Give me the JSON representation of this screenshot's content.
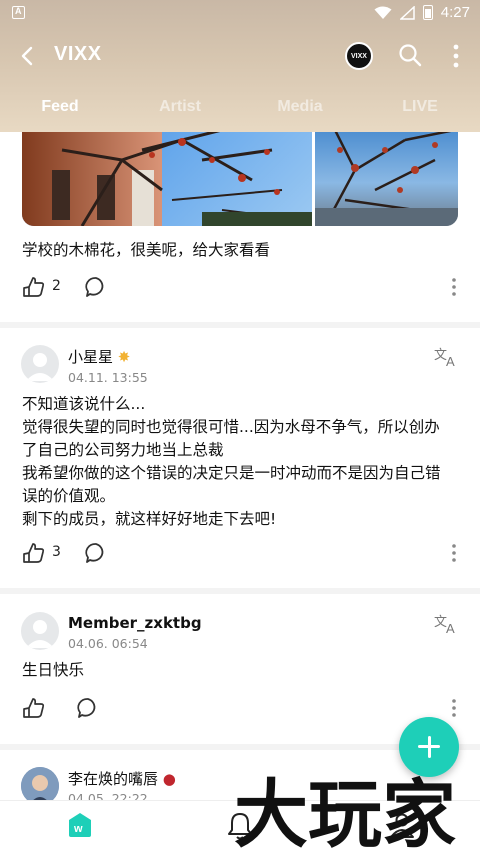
{
  "statusbar": {
    "time": "4:27"
  },
  "appbar": {
    "title": "VIXX",
    "logo_text": "VIXX"
  },
  "tabs": [
    {
      "label": "Feed",
      "active": true
    },
    {
      "label": "Artist",
      "active": false
    },
    {
      "label": "Media",
      "active": false
    },
    {
      "label": "LIVE",
      "active": false
    }
  ],
  "posts": [
    {
      "text": "学校的木棉花，很美呢，给大家看看",
      "likes": "2"
    },
    {
      "username": "小星星",
      "time": "04.11. 13:55",
      "lines": [
        "不知道该说什么...",
        "觉得很失望的同时也觉得很可惜...因为水母不争气，所以创办",
        "了自己的公司努力地当上总裁",
        "我希望你做的这个错误的决定只是一时冲动而不是因为自己错",
        "误的价值观。",
        "剩下的成员，就这样好好地走下去吧!"
      ],
      "likes": "3"
    },
    {
      "username": "Member_zxktbg",
      "time": "04.06. 06:54",
      "text": "生日快乐",
      "likes": ""
    },
    {
      "username": "李在焕的嘴唇",
      "time": "04.05. 22:22"
    }
  ],
  "watermark": {
    "text": "大玩家"
  },
  "colors": {
    "accent": "#1ecfb8",
    "header": "#d7c6b0"
  }
}
